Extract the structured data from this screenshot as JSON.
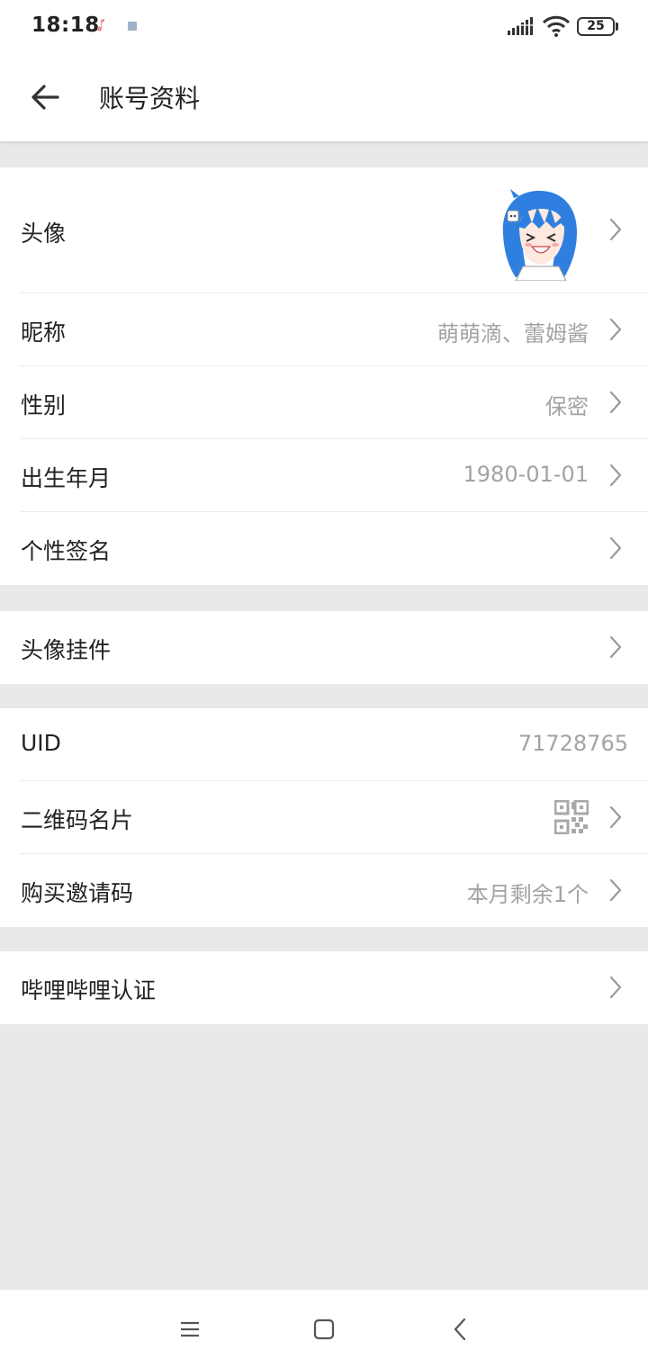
{
  "status_bar": {
    "time": "18:18",
    "battery_level": "25",
    "icons": [
      "music-notification-icon",
      "app-notification-icon",
      "signal-icon",
      "wifi-icon",
      "battery-icon"
    ]
  },
  "header": {
    "title": "账号资料",
    "back_icon": "arrow-left-icon"
  },
  "profile": {
    "avatar_label": "头像",
    "nickname_label": "昵称",
    "nickname_value": "萌萌滴、蕾姆酱",
    "gender_label": "性别",
    "gender_value": "保密",
    "birthday_label": "出生年月",
    "birthday_value": "1980-01-01",
    "signature_label": "个性签名"
  },
  "pendant": {
    "label": "头像挂件"
  },
  "account": {
    "uid_label": "UID",
    "uid_value": "71728765",
    "qrcode_label": "二维码名片",
    "invite_label": "购买邀请码",
    "invite_value": "本月剩余1个"
  },
  "certification": {
    "label": "哔哩哔哩认证"
  },
  "nav_bar": {
    "buttons": [
      "menu-icon",
      "home-icon",
      "back-icon"
    ]
  },
  "colors": {
    "background": "#e9e9e9",
    "card": "#ffffff",
    "value_text": "#a3a3a3",
    "avatar_hair": "#2f7fe0"
  }
}
